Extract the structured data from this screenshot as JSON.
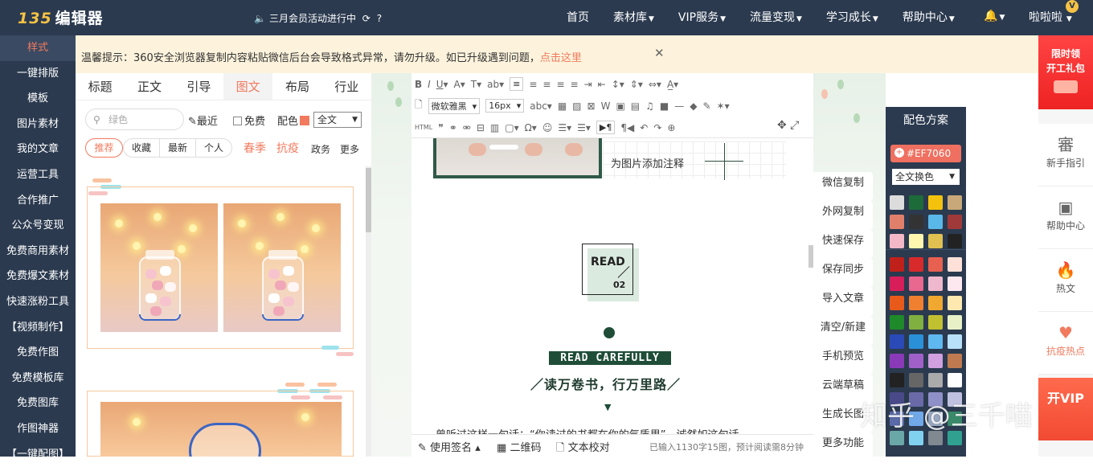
{
  "topbar": {
    "logo_prefix": "135",
    "logo_text": "编辑器",
    "promo_icon": "speaker-icon",
    "promo": "三月会员活动进行中",
    "nav": [
      {
        "label": "首页",
        "dropdown": false
      },
      {
        "label": "素材库",
        "dropdown": true
      },
      {
        "label": "VIP服务",
        "dropdown": true
      },
      {
        "label": "流量变现",
        "dropdown": true
      },
      {
        "label": "学习成长",
        "dropdown": true
      },
      {
        "label": "帮助中心",
        "dropdown": true
      }
    ],
    "user": "啦啦啦",
    "badge": "V"
  },
  "sidebar": [
    "样式",
    "一键排版",
    "模板",
    "图片素材",
    "我的文章",
    "运营工具",
    "合作推广",
    "公众号变现",
    "免费商用素材",
    "免费爆文素材",
    "快速涨粉工具",
    "【视频制作】",
    "免费作图",
    "免费模板库",
    "免费图库",
    "作图神器",
    "【一键配图】"
  ],
  "notice": {
    "text": "温馨提示：360安全浏览器复制内容粘贴微信后台会导致格式异常，请勿升级。如已升级遇到问题，",
    "link": "点击这里"
  },
  "tabs": [
    "标题",
    "正文",
    "引导",
    "图文",
    "布局",
    "行业"
  ],
  "active_tab": "图文",
  "filter": {
    "search_placeholder": "绿色",
    "recent": "最近",
    "free": "免费",
    "color_label": "配色",
    "color_value": "#EF7060",
    "scope": "全文",
    "pills": [
      "推荐",
      "收藏",
      "最新",
      "个人"
    ],
    "hot_tags": [
      "春季",
      "抗疫"
    ],
    "tags": [
      "政务",
      "更多"
    ]
  },
  "toolbar": {
    "font": "微软雅黑",
    "size": "16px",
    "html": "HTML"
  },
  "doc": {
    "caption": "为图片添加注释",
    "read": "READ",
    "read_num": "02",
    "read_carefully": "READ CAREFULLY",
    "motto": "／读万卷书，行万里路／",
    "body": "曾听过这样一句话：“你读过的书都在你的气质里”，诚然如这句话"
  },
  "bottombar": {
    "sign": "使用签名",
    "qrcode": "二维码",
    "proof": "文本校对",
    "status": "已输入1130字15图，预计阅读需8分钟"
  },
  "actions": [
    "微信复制",
    "外网复制",
    "快速保存",
    "保存同步",
    "导入文章",
    "清空/新建",
    "手机预览",
    "云端草稿",
    "生成长图",
    "更多功能"
  ],
  "scheme": {
    "title": "配色方案",
    "hex": "#EF7060",
    "mode": "全文换色",
    "colors": [
      "#dcdcdc",
      "#1e6b3a",
      "#f4c20d",
      "#c8a878",
      "#e0806a",
      "#333333",
      "#5ab8e8",
      "#a03a3a",
      "#f2b8c8",
      "#fff7b0",
      "#e0c050",
      "#222222",
      "#c0201a",
      "#d82a2a",
      "#e86050",
      "#fde0d8",
      "#d81e5a",
      "#e86890",
      "#f0b8cc",
      "#fde8f0",
      "#e85a1a",
      "#f08030",
      "#f0a830",
      "#fde8b0",
      "#1e8a2a",
      "#80b040",
      "#c0c030",
      "#e8f0c8",
      "#2a4ab8",
      "#2a90d8",
      "#60b8f0",
      "#b8e0f8",
      "#8a3ab8",
      "#a060c8",
      "#d0a0e0",
      "#c07a50",
      "#222222",
      "#666666",
      "#aaaaaa",
      "#ffffff",
      "#4a4a8a",
      "#6a6aa8",
      "#9090c8",
      "#c0c0e0",
      "#5a6aa8",
      "#70a8e8",
      "#98a8c0",
      "#3a8a6a",
      "#6aa8a8",
      "#80d0f0",
      "#808890",
      "#30a090"
    ]
  },
  "right": {
    "gift": [
      "限时领",
      "开工礼包"
    ],
    "items": [
      {
        "icon": "guide-icon",
        "glyph": "審",
        "label": "新手指引"
      },
      {
        "icon": "help-icon",
        "glyph": "▣",
        "label": "帮助中心"
      },
      {
        "icon": "flame-icon",
        "glyph": "🔥",
        "label": "热文"
      },
      {
        "icon": "heart-hands-icon",
        "glyph": "♥",
        "label": "抗疫热点"
      }
    ],
    "vip": "开VIP"
  },
  "watermark": "知乎 @三千喵"
}
